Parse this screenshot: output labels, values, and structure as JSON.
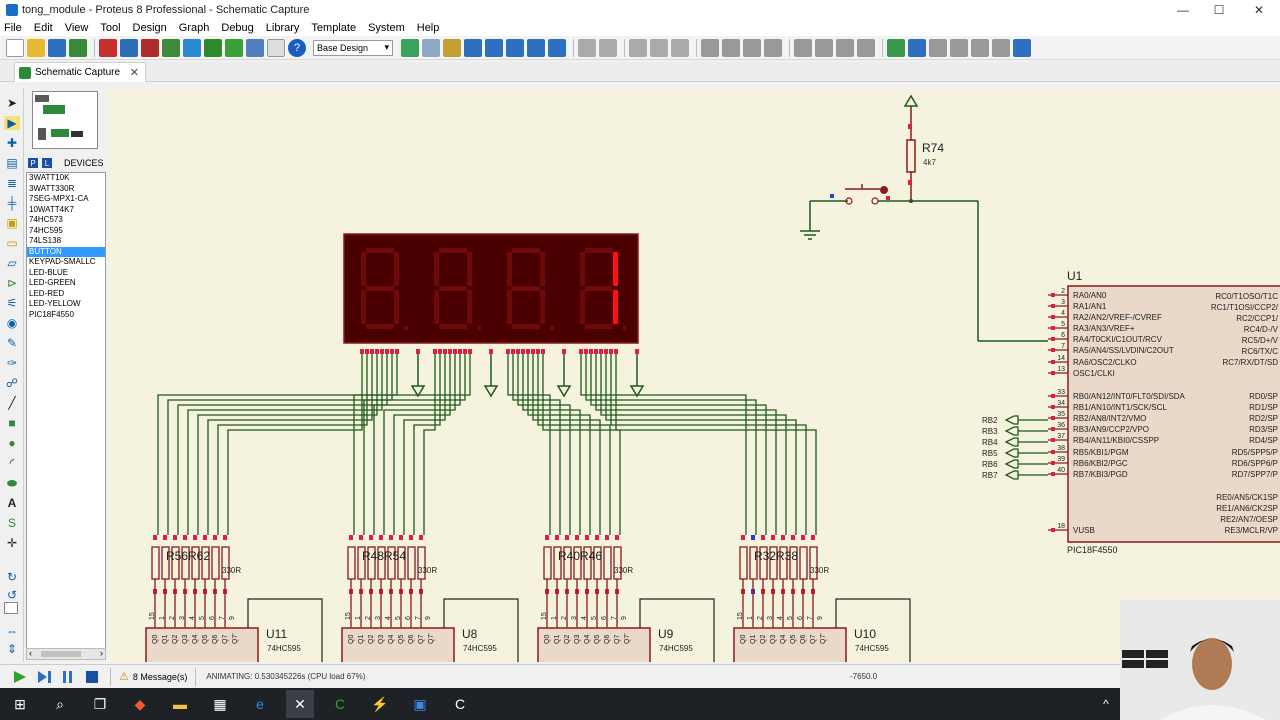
{
  "window": {
    "title": "tong_module - Proteus 8 Professional - Schematic Capture",
    "minimize": "—",
    "maximize": "☐",
    "close": "✕"
  },
  "menu": [
    "File",
    "Edit",
    "View",
    "Tool",
    "Design",
    "Graph",
    "Debug",
    "Library",
    "Template",
    "System",
    "Help"
  ],
  "toolbar": {
    "design_combo": "Base Design"
  },
  "tab": {
    "label": "Schematic Capture",
    "close": "✕"
  },
  "devices": {
    "header": "DEVICES",
    "p_label": "P",
    "l_label": "L",
    "items": [
      "3WATT10K",
      "3WATT330R",
      "7SEG-MPX1-CA",
      "10WATT4K7",
      "74HC573",
      "74HC595",
      "74LS138",
      "BUTTON",
      "KEYPAD-SMALLC",
      "LED-BLUE",
      "LED-GREEN",
      "LED-RED",
      "LED-YELLOW",
      "PIC18F4550"
    ],
    "selected_index": 7
  },
  "schematic": {
    "r74": {
      "ref": "R74",
      "value": "4k7"
    },
    "display": {
      "digits_shown": [
        "",
        "",
        "",
        "1"
      ]
    },
    "u1": {
      "ref": "U1",
      "part": "PIC18F4550",
      "left_pins": [
        {
          "num": "2",
          "name": "RA0/AN0"
        },
        {
          "num": "3",
          "name": "RA1/AN1"
        },
        {
          "num": "4",
          "name": "RA2/AN2/VREF-/CVREF"
        },
        {
          "num": "5",
          "name": "RA3/AN3/VREF+"
        },
        {
          "num": "6",
          "name": "RA4/T0CKI/C1OUT/RCV"
        },
        {
          "num": "7",
          "name": "RA5/AN4/SS/LVDIN/C2OUT"
        },
        {
          "num": "14",
          "name": "RA6/OSC2/CLKO"
        },
        {
          "num": "13",
          "name": "OSC1/CLKI"
        },
        {
          "num": "33",
          "name": "RB0/AN12/INT0/FLT0/SDI/SDA"
        },
        {
          "num": "34",
          "name": "RB1/AN10/INT1/SCK/SCL"
        },
        {
          "num": "35",
          "name": "RB2/AN8/INT2/VMO"
        },
        {
          "num": "36",
          "name": "RB3/AN9/CCP2/VPO"
        },
        {
          "num": "37",
          "name": "RB4/AN11/KBI0/CSSPP"
        },
        {
          "num": "38",
          "name": "RB5/KBI1/PGM"
        },
        {
          "num": "39",
          "name": "RB6/KBI2/PGC"
        },
        {
          "num": "40",
          "name": "RB7/KBI3/PGD"
        },
        {
          "num": "18",
          "name": "VUSB"
        }
      ],
      "right_pins": [
        "RC0/T1OSO/T1C",
        "RC1/T1OSI/CCP2/",
        "RC2/CCP1/",
        "RC4/D-/V",
        "RC5/D+/V",
        "RC6/TX/C",
        "RC7/RX/DT/SD",
        "RD0/SP",
        "RD1/SP",
        "RD2/SP",
        "RD3/SP",
        "RD4/SP",
        "RD5/SPP5/P",
        "RD6/SPP6/P",
        "RD7/SPP7/P",
        "RE0/AN5/CK1SP",
        "RE1/AN6/CK2SP",
        "RE2/AN7/OESP",
        "RE3/MCLR/VP"
      ]
    },
    "rb_labels": [
      "RB2",
      "RB3",
      "RB4",
      "RB5",
      "RB6",
      "RB7"
    ],
    "shift_registers": [
      {
        "ref": "U11",
        "part": "74HC595",
        "res_label": "R56R62",
        "res_value": "330R"
      },
      {
        "ref": "U8",
        "part": "74HC595",
        "res_label": "R48R54",
        "res_value": "330R"
      },
      {
        "ref": "U9",
        "part": "74HC595",
        "res_label": "R40R46",
        "res_value": "330R"
      },
      {
        "ref": "U10",
        "part": "74HC595",
        "res_label": "R32R38",
        "res_value": "330R"
      }
    ],
    "q_pins": [
      "Q0",
      "Q1",
      "Q2",
      "Q3",
      "Q4",
      "Q5",
      "Q6",
      "Q7",
      "Q7'"
    ],
    "q_pin_nums": [
      "15",
      "1",
      "2",
      "3",
      "4",
      "5",
      "6",
      "7",
      "9"
    ]
  },
  "status": {
    "messages": "8 Message(s)",
    "animating": "ANIMATING: 0.530345226s (CPU load 67%)",
    "coord": "-7650.0"
  },
  "colors": {
    "canvas": "#f5f2dd",
    "wire": "#1d5a1d",
    "component": "#8b1a1a",
    "display_bg": "#4a0000",
    "segment_on": "#ff1010",
    "segment_off": "#6e0a0a"
  }
}
